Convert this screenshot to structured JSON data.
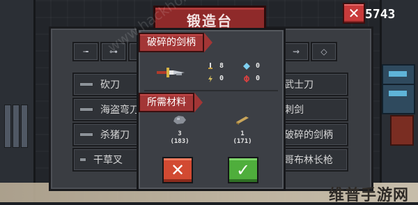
{
  "header": {
    "title": "锻造台",
    "close_label": "✕",
    "counter": "5743"
  },
  "category_tabs": [
    "╼",
    "⊶",
    "⋉",
    "⚔",
    "◇",
    "◇",
    "⇝",
    "◇"
  ],
  "weapon_list": {
    "left": [
      "砍刀",
      "海盗弯刀",
      "杀猪刀",
      "干草叉"
    ],
    "right": [
      "武士刀",
      "刺剑",
      "破碎的剑柄",
      "哥布林长枪"
    ]
  },
  "recipe": {
    "item_name": "破碎的剑柄",
    "stats": {
      "damage": "8",
      "crit": "0",
      "energy": "0",
      "accuracy": "0"
    },
    "materials_title": "所需材料",
    "materials": [
      {
        "icon": "iron-ore-icon",
        "required": "3",
        "owned": "(183)"
      },
      {
        "icon": "wood-plank-icon",
        "required": "1",
        "owned": "(171)"
      }
    ],
    "cancel_label": "✕",
    "confirm_label": "✓"
  },
  "watermark": {
    "site": "www.hackhome.com",
    "logo": "维普手游网"
  },
  "colors": {
    "title_banner": "#8f2a2a",
    "cancel": "#d24a32",
    "confirm": "#4fae3c"
  }
}
